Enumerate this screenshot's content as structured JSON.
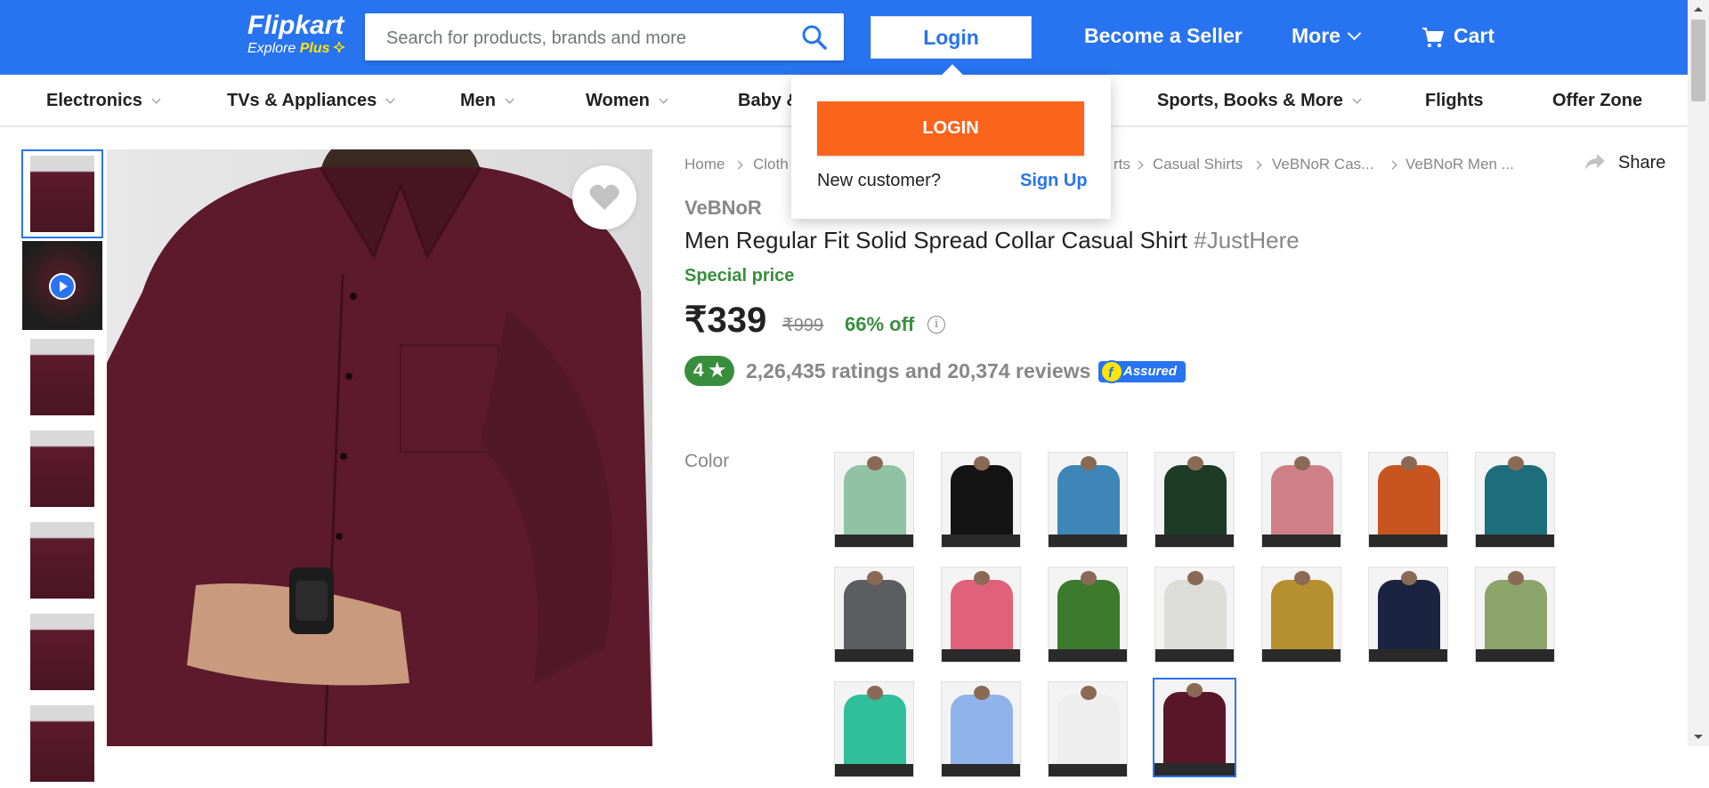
{
  "header": {
    "logo": "Flipkart",
    "logo_sub": "Explore",
    "logo_plus": "Plus",
    "search_placeholder": "Search for products, brands and more",
    "login": "Login",
    "become_seller": "Become a Seller",
    "more": "More",
    "cart": "Cart",
    "brand_color": "#2874f0"
  },
  "categories": [
    {
      "label": "Electronics"
    },
    {
      "label": "TVs & Appliances"
    },
    {
      "label": "Men"
    },
    {
      "label": "Women"
    },
    {
      "label": "Baby &"
    },
    {
      "label": "Sports, Books & More"
    },
    {
      "label": "Flights"
    },
    {
      "label": "Offer Zone"
    }
  ],
  "login_dropdown": {
    "login_button": "LOGIN",
    "new_customer": "New customer?",
    "sign_up": "Sign Up"
  },
  "breadcrumb": [
    "Home",
    "Cloth",
    "rts",
    "Casual Shirts",
    "VeBNoR Cas...",
    "VeBNoR Men ..."
  ],
  "share": "Share",
  "product": {
    "brand": "VeBNoR",
    "title": "Men Regular Fit Solid Spread Collar Casual Shirt",
    "hashtag": "#JustHere",
    "special_price": "Special price",
    "price": "₹339",
    "mrp": "₹999",
    "discount": "66% off",
    "info": "i",
    "rating": "4",
    "rating_star": "★",
    "reviews": "2,26,435 ratings and 20,374 reviews",
    "assured": "Assured"
  },
  "color_label": "Color",
  "swatches": [
    {
      "color": "#8fc3a4"
    },
    {
      "color": "#141414"
    },
    {
      "color": "#3f86b8"
    },
    {
      "color": "#1d3b26"
    },
    {
      "color": "#cf7f86"
    },
    {
      "color": "#c8551f"
    },
    {
      "color": "#1c6e7a"
    },
    {
      "color": "#5c5d60"
    },
    {
      "color": "#e0617a"
    },
    {
      "color": "#3c7b2c"
    },
    {
      "color": "#dcdcd8"
    },
    {
      "color": "#b6902e"
    },
    {
      "color": "#1a2440"
    },
    {
      "color": "#8aa46a"
    },
    {
      "color": "#2fbf9b"
    },
    {
      "color": "#8fb3ea"
    },
    {
      "color": "#eeeeee"
    },
    {
      "color": "#5a1629"
    }
  ],
  "thumbnails": [
    {
      "type": "image"
    },
    {
      "type": "video"
    },
    {
      "type": "image"
    },
    {
      "type": "image"
    },
    {
      "type": "image"
    },
    {
      "type": "image"
    },
    {
      "type": "image"
    }
  ]
}
